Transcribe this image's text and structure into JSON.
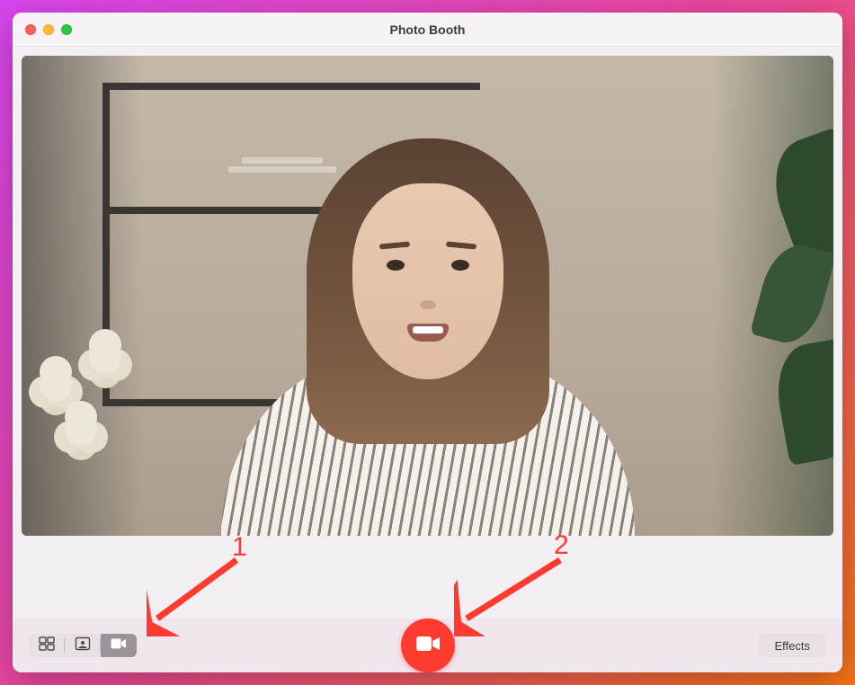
{
  "window": {
    "title": "Photo Booth"
  },
  "toolbar": {
    "modes": {
      "four_up_icon": "grid-four-icon",
      "single_icon": "single-frame-icon",
      "video_icon": "video-camera-icon",
      "active": "video"
    },
    "record_icon": "video-camera-icon",
    "effects_label": "Effects"
  },
  "annotations": {
    "label_1": "1",
    "label_2": "2"
  }
}
